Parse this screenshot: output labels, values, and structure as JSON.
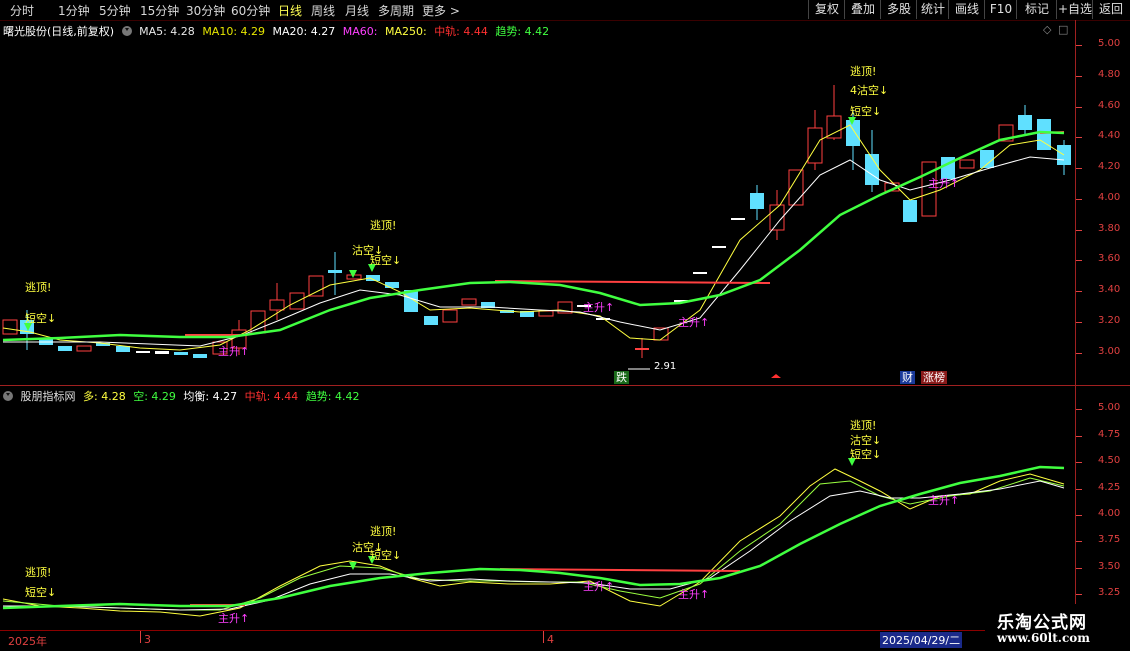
{
  "periods": [
    "分时",
    "1分钟",
    "5分钟",
    "15分钟",
    "30分钟",
    "60分钟",
    "日线",
    "周线",
    "月线",
    "多周期",
    "更多 >"
  ],
  "active_period": "日线",
  "tools": [
    "复权",
    "叠加",
    "多股",
    "统计",
    "画线",
    "F10",
    "标记",
    "+自选",
    "返回"
  ],
  "main": {
    "stock_title": "曙光股份(日线,前复权)",
    "indicators": [
      {
        "label": "MA5: 4.28",
        "color": "#e8e8e8"
      },
      {
        "label": "MA10: 4.29",
        "color": "#e6e600"
      },
      {
        "label": "MA20: 4.27",
        "color": "#ffffff"
      },
      {
        "label": "MA60:",
        "color": "#ff40ff"
      },
      {
        "label": "MA250:",
        "color": "#ffff40"
      },
      {
        "label": "中轨: 4.44",
        "color": "#ff3030"
      },
      {
        "label": "趋势: 4.42",
        "color": "#40ff40"
      }
    ],
    "yaxis": [
      "5.00",
      "4.80",
      "4.60",
      "4.40",
      "4.20",
      "4.00",
      "3.80",
      "3.60",
      "3.40",
      "3.20",
      "3.00"
    ],
    "signals": [
      "逃顶!",
      "逃顶!",
      "逃顶!",
      "短空↓",
      "短空↓",
      "短空↓",
      "沽空↓",
      "4沽空↓",
      "主升↑",
      "主升↑",
      "主升↑",
      "主升↑"
    ],
    "low_label": "2.91",
    "tags": {
      "die": "跌",
      "cai": "财",
      "zhangbang": "涨榜"
    }
  },
  "sub": {
    "title": "股朋指标网",
    "indicators": [
      {
        "label": "多: 4.28",
        "color": "#ffff40"
      },
      {
        "label": "空: 4.29",
        "color": "#40ff40"
      },
      {
        "label": "均衡: 4.27",
        "color": "#ffffff"
      },
      {
        "label": "中轨: 4.44",
        "color": "#ff3030"
      },
      {
        "label": "趋势: 4.42",
        "color": "#40ff40"
      }
    ],
    "yaxis": [
      "5.00",
      "4.75",
      "4.50",
      "4.25",
      "4.00",
      "3.75",
      "3.50",
      "3.25"
    ],
    "signals": [
      "逃顶!",
      "逃顶!",
      "逃顶!",
      "短空↓",
      "短空↓",
      "短空↓",
      "沽空↓",
      "沽空↓",
      "主升↑",
      "主升↑",
      "主升↑",
      "主升↑"
    ]
  },
  "timeline": {
    "year": "2025年",
    "m3": "3",
    "m4": "4",
    "cursor_date": "2025/04/29/二"
  },
  "watermark": {
    "line1": "乐淘公式网",
    "line2": "www.60lt.com"
  }
}
